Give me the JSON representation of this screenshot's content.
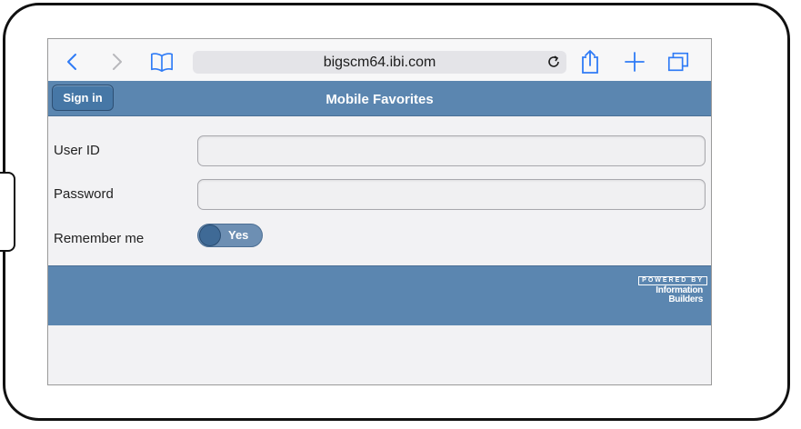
{
  "browser": {
    "url": "bigscm64.ibi.com",
    "icons": [
      "back-icon",
      "forward-icon",
      "bookmarks-icon",
      "reload-icon",
      "share-icon",
      "new-tab-icon",
      "tabs-icon"
    ]
  },
  "header": {
    "sign_in_label": "Sign in",
    "title": "Mobile Favorites"
  },
  "form": {
    "user_id_label": "User ID",
    "user_id_value": "",
    "password_label": "Password",
    "password_value": "",
    "remember_label": "Remember me",
    "remember_toggle_label": "Yes",
    "remember_on": true
  },
  "footer": {
    "powered_by": "POWERED BY",
    "brand_line1": "Information",
    "brand_line2": "Builders"
  },
  "colors": {
    "accent": "#5b86b0",
    "button": "#4677a6",
    "icon_blue": "#2f7bf6",
    "background": "#f2f2f4"
  }
}
